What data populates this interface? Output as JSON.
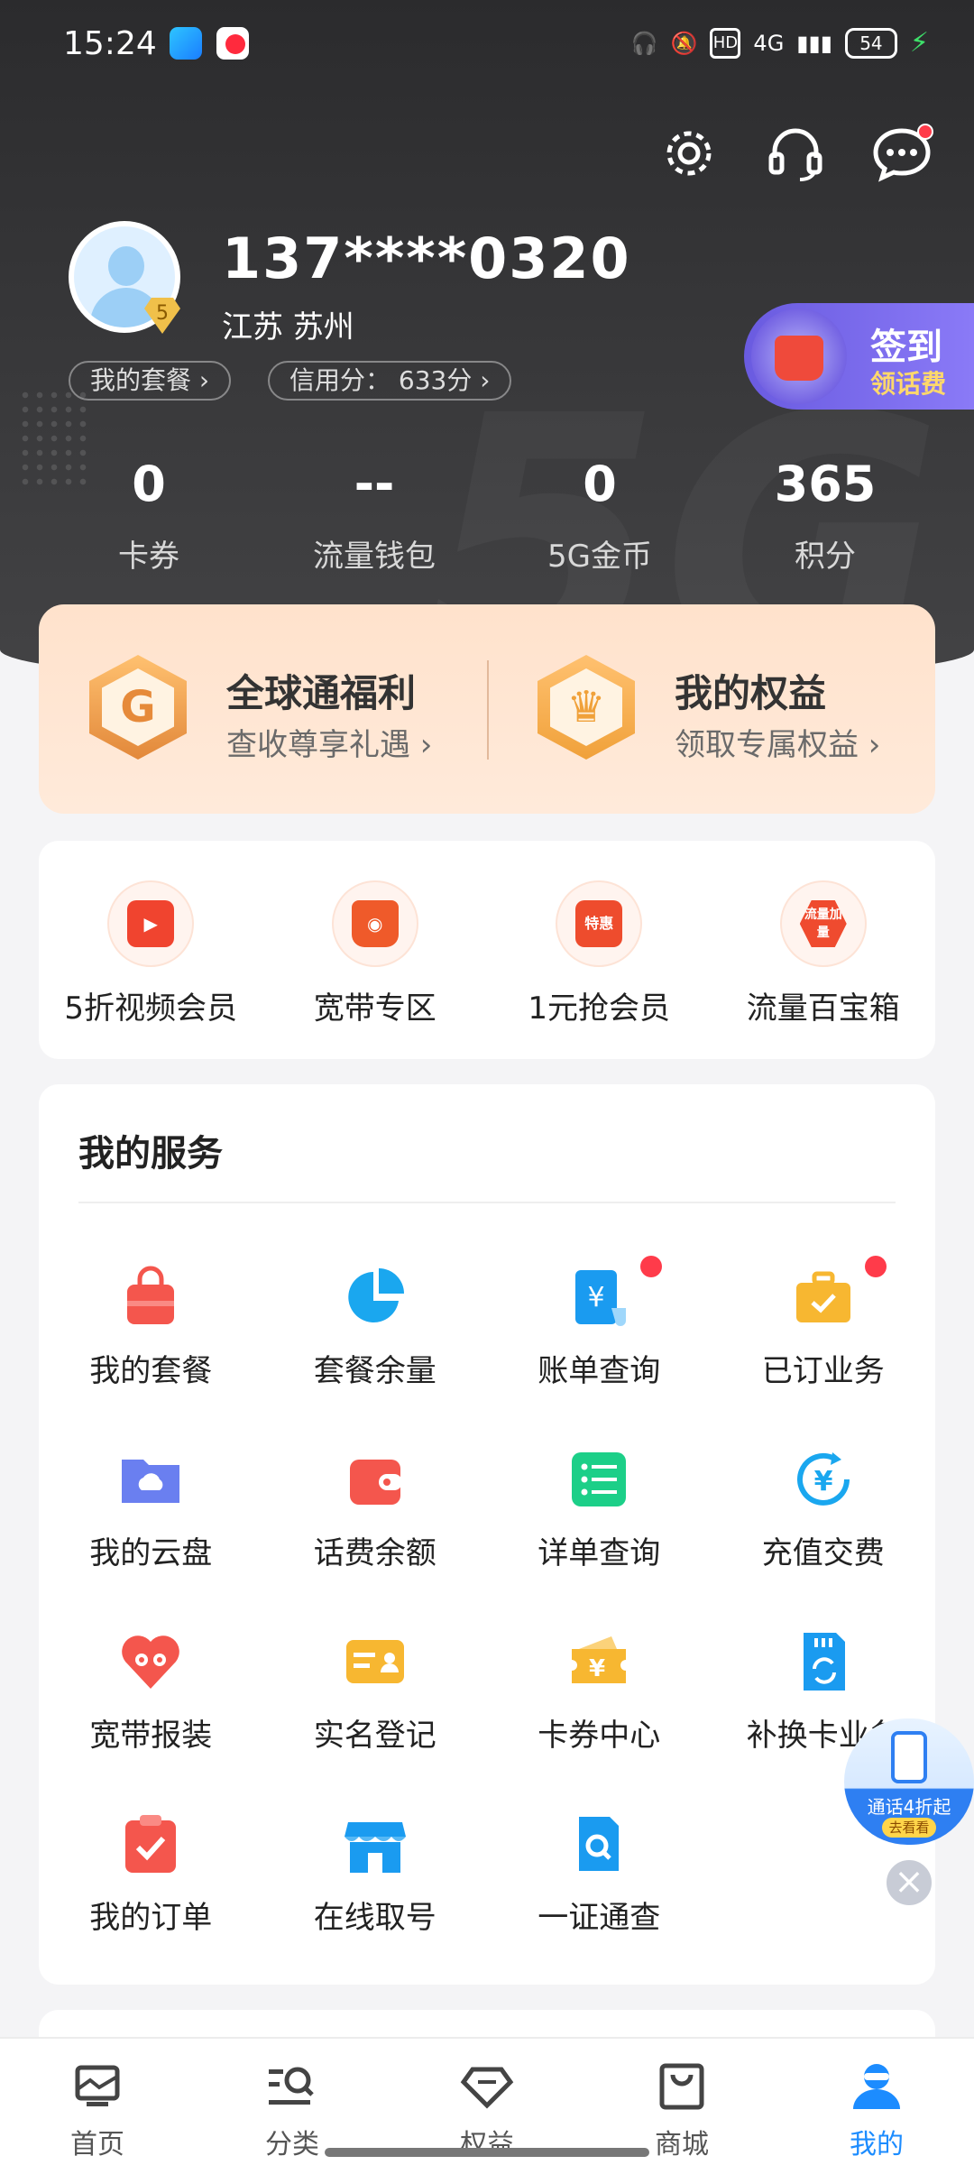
{
  "status_bar": {
    "time": "15:24",
    "hd": "HD",
    "network": "4G",
    "battery": "54"
  },
  "profile": {
    "phone": "137****0320",
    "region": "江苏  苏州",
    "level": "5",
    "my_plan": "我的套餐 ›",
    "credit": "信用分： 633分 ›"
  },
  "signin": {
    "title": "签到",
    "subtitle": "领话费"
  },
  "stats": [
    {
      "value": "0",
      "label": "卡券"
    },
    {
      "value": "--",
      "label": "流量钱包"
    },
    {
      "value": "0",
      "label": "5G金币"
    },
    {
      "value": "365",
      "label": "积分"
    }
  ],
  "benefits": [
    {
      "title": "全球通福利",
      "subtitle": "查收尊享礼遇 ›"
    },
    {
      "title": "我的权益",
      "subtitle": "领取专属权益 ›"
    }
  ],
  "quick": [
    {
      "label": "5折视频会员",
      "icon": "video-icon",
      "color": "#f0442f"
    },
    {
      "label": "宽带专区",
      "icon": "bag-icon",
      "color": "#ef5a2a"
    },
    {
      "label": "1元抢会员",
      "icon": "crown-icon",
      "color": "#ee4c2d",
      "badge": "特惠"
    },
    {
      "label": "流量百宝箱",
      "icon": "hexagon-icon",
      "color": "#ef4b2f",
      "badge": "流量加量"
    }
  ],
  "services": {
    "title": "我的服务",
    "items": [
      {
        "label": "我的套餐",
        "icon": "bag-icon",
        "color": "#f4564d"
      },
      {
        "label": "套餐余量",
        "icon": "pie-icon",
        "color": "#1aa7ef"
      },
      {
        "label": "账单查询",
        "icon": "bill-icon",
        "color": "#1a9bf0",
        "dot": true
      },
      {
        "label": "已订业务",
        "icon": "briefcase-icon",
        "color": "#f7b731",
        "dot": true
      },
      {
        "label": "我的云盘",
        "icon": "folder-cloud-icon",
        "color": "#6a7ff0"
      },
      {
        "label": "话费余额",
        "icon": "wallet-icon",
        "color": "#f4564d"
      },
      {
        "label": "详单查询",
        "icon": "list-icon",
        "color": "#1ccf88"
      },
      {
        "label": "充值交费",
        "icon": "yen-refresh-icon",
        "color": "#1aa7ef"
      },
      {
        "label": "宽带报装",
        "icon": "heart-icon",
        "color": "#f4564d"
      },
      {
        "label": "实名登记",
        "icon": "id-card-icon",
        "color": "#f7b731"
      },
      {
        "label": "卡券中心",
        "icon": "ticket-icon",
        "color": "#f7b731"
      },
      {
        "label": "补换卡业务",
        "icon": "sim-icon",
        "color": "#1a9bf0"
      },
      {
        "label": "我的订单",
        "icon": "clipboard-check-icon",
        "color": "#f4564d"
      },
      {
        "label": "在线取号",
        "icon": "store-icon",
        "color": "#1a9bf0"
      },
      {
        "label": "一证通查",
        "icon": "sim-search-icon",
        "color": "#1a9bf0"
      }
    ]
  },
  "float_ad": {
    "text": "通话4折起",
    "button": "去看看"
  },
  "bottom_nav": [
    {
      "label": "首页",
      "icon": "home-icon"
    },
    {
      "label": "分类",
      "icon": "category-search-icon"
    },
    {
      "label": "权益",
      "icon": "diamond-icon"
    },
    {
      "label": "商城",
      "icon": "shopping-bag-icon"
    },
    {
      "label": "我的",
      "icon": "user-icon",
      "active": true
    }
  ],
  "colors": {
    "accent": "#1c8cff",
    "header_bg": "#2f2f31",
    "red_dot": "#ff3b4a"
  }
}
